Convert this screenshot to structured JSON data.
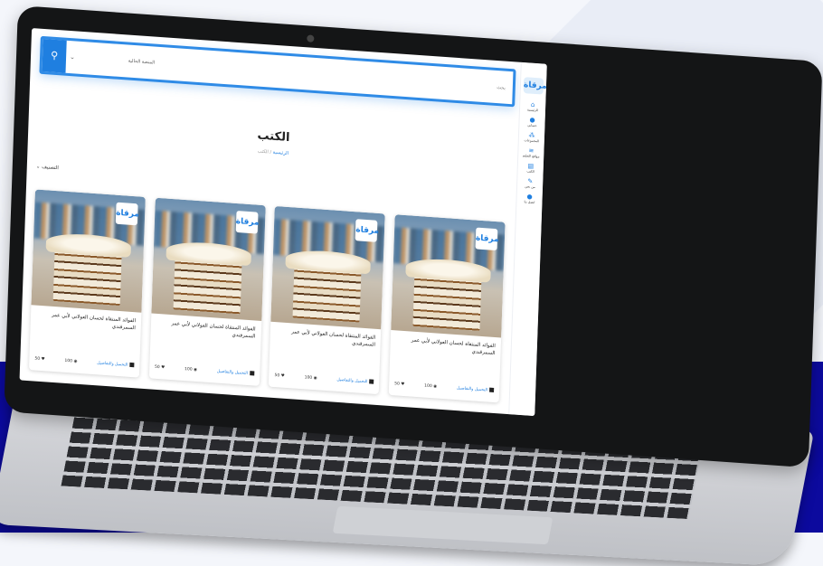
{
  "header": {
    "search_button_icon": "search-icon",
    "scope_label": "المنصة الحالية",
    "search_placeholder": "بحث"
  },
  "sidebar": {
    "logo_text": "مرقاة",
    "items": [
      {
        "icon": "home-icon",
        "glyph": "⌂",
        "label": "الرئيسية"
      },
      {
        "icon": "user-icon",
        "glyph": "●",
        "label": "حسابي"
      },
      {
        "icon": "people-icon",
        "glyph": "⁂",
        "label": "المجموعات"
      },
      {
        "icon": "list-icon",
        "glyph": "≡",
        "label": "مواقع التعليم"
      },
      {
        "icon": "book-icon",
        "glyph": "▤",
        "label": "الكتب"
      },
      {
        "icon": "pen-icon",
        "glyph": "✎",
        "label": "من نحن"
      },
      {
        "icon": "contact-icon",
        "glyph": "●",
        "label": "اتصل بنا"
      }
    ]
  },
  "page": {
    "title": "الكتب",
    "breadcrumb": {
      "home": "الرئيسية",
      "separator": "/",
      "current": "الكتب"
    },
    "filter_label": "التصنيف"
  },
  "cards": [
    {
      "title": "الفوائد المنتقاة لحسان العولاني لأبي عمر السمرقندي",
      "details": "التحميل والتفاصيل",
      "views": "100",
      "likes": "50"
    },
    {
      "title": "الفوائد المنتقاة لحسان العولاني لأبي عمر السمرقندي",
      "details": "التحميل والتفاصيل",
      "views": "100",
      "likes": "50"
    },
    {
      "title": "الفوائد المنتقاة لحسان العولاني لأبي عمر السمرقندي",
      "details": "التحميل والتفاصيل",
      "views": "100",
      "likes": "50"
    },
    {
      "title": "الفوائد المنتقاة لحسان العولاني لأبي عمر السمرقندي",
      "details": "التحميل والتفاصيل",
      "views": "100",
      "likes": "50"
    }
  ],
  "colors": {
    "accent": "#1f7fe0",
    "band": "#0c0a9e"
  }
}
